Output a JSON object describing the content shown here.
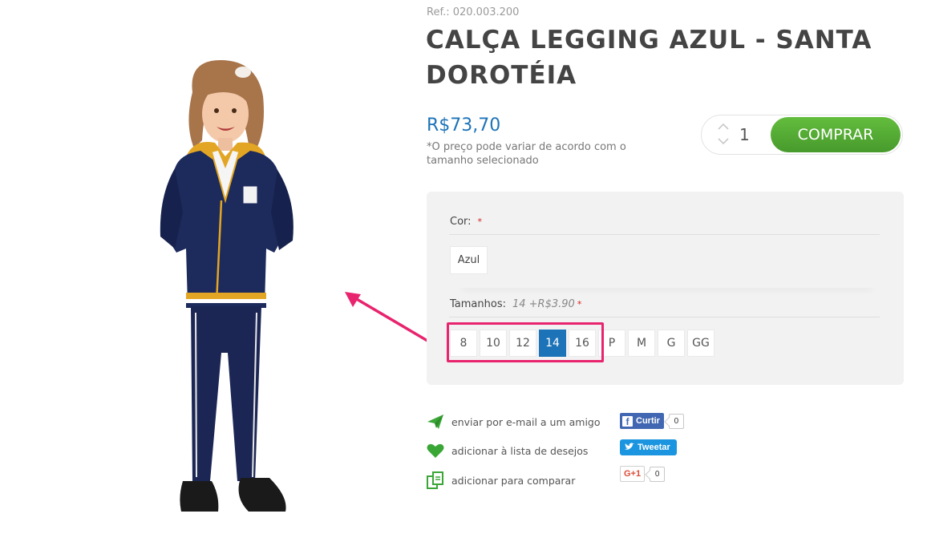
{
  "product": {
    "ref": "Ref.: 020.003.200",
    "title": "CALÇA LEGGING AZUL - SANTA DOROTÉIA",
    "price": "R$73,70",
    "price_note": "*O preço pode variar de acordo com o tamanho selecionado"
  },
  "purchase": {
    "quantity": "1",
    "up_icon": "chevron-up-icon",
    "down_icon": "chevron-down-icon",
    "buy_label": "COMPRAR"
  },
  "options": {
    "color_label": "Cor:",
    "color_required": "*",
    "color_value": "Azul",
    "sizes_label": "Tamanhos:",
    "selected_size_hint": "14 +R$3.90",
    "sizes_required": "*",
    "sizes": [
      "8",
      "10",
      "12",
      "14",
      "16",
      "P",
      "M",
      "G",
      "GG"
    ],
    "selected_size": "14"
  },
  "actions": [
    {
      "label": "enviar por e-mail a um amigo",
      "icon": "paper-plane-icon"
    },
    {
      "label": "adicionar à lista de desejos",
      "icon": "heart-icon"
    },
    {
      "label": "adicionar para comparar",
      "icon": "compare-icon"
    }
  ],
  "social": {
    "facebook_label": "Curtir",
    "facebook_count": "0",
    "twitter_label": "Tweetar",
    "gplus_label": "G+1",
    "gplus_count": "0"
  },
  "colors": {
    "price_blue": "#1d73b8",
    "buy_green": "#51a734",
    "highlight_pink": "#e8246e",
    "panel_bg": "#f2f2f2",
    "action_green": "#3aa636"
  }
}
